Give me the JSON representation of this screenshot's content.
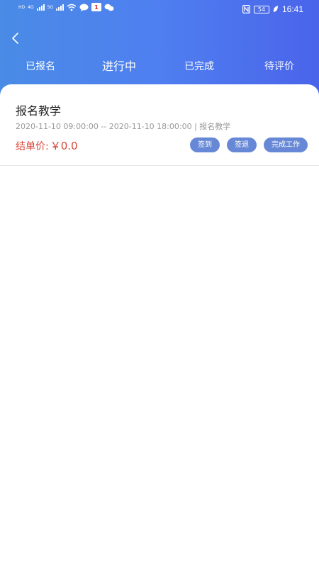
{
  "status_bar": {
    "left_labels": [
      "HD",
      "4G",
      "5G"
    ],
    "app_badge": "1",
    "battery": "54",
    "time": "16:41",
    "icons": [
      "hd-icon",
      "signal-icon",
      "wifi-icon",
      "chat-bubble-icon",
      "app-badge-icon",
      "wechat-icon",
      "nfc-icon",
      "battery-icon",
      "leaf-icon"
    ]
  },
  "nav": {
    "back_icon": "chevron-left-icon",
    "tabs": [
      {
        "label": "已报名",
        "active": false
      },
      {
        "label": "进行中",
        "active": true
      },
      {
        "label": "已完成",
        "active": false
      },
      {
        "label": "待评价",
        "active": false
      }
    ]
  },
  "orders": [
    {
      "title": "报名教学",
      "meta": "2020-11-10 09:00:00 -- 2020-11-10 18:00:00 | 报名教学",
      "price_label": "结单价:",
      "price_value": "￥0.0",
      "actions": [
        "签到",
        "签退",
        "完成工作"
      ]
    }
  ],
  "colors": {
    "header_gradient_start": "#4a8be6",
    "header_gradient_end": "#4a64ea",
    "button_bg": "#6688d6",
    "price_red": "#d9463b",
    "meta_gray": "#999999"
  }
}
